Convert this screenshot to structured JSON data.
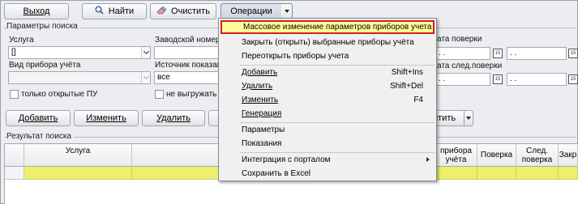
{
  "toolbar": {
    "exit": "Выход",
    "find": "Найти",
    "clear": "Очистить",
    "operations": "Операции"
  },
  "search_params": {
    "title": "Параметры поиска",
    "service_label": "Услуга",
    "service_value": "[]",
    "serial_label": "Заводской номер",
    "device_type_label": "Вид прибора учёта",
    "readings_source_label": "Источник показаний",
    "readings_source_value": "все",
    "only_open_label": "только открытые ПУ",
    "no_export_label": "не выгружать на",
    "verify_date_label": "ата поверки",
    "next_verify_label": "ата след.поверки",
    "date_placeholder": ". .",
    "date_placeholder_2": ". ."
  },
  "actions": {
    "add": "Добавить",
    "edit": "Изменить",
    "delete": "Удалить",
    "right_partial": "итить"
  },
  "results": {
    "title": "Результат поиска",
    "columns": [
      "Услуга",
      "прибора\nучёта",
      "Поверка",
      "След.\nповерка",
      "Закр"
    ]
  },
  "menu": {
    "items": [
      {
        "label": "Массовое изменение параметров приборов учета",
        "shortcut": "",
        "highlighted": true
      },
      {
        "label": "Закрыть (открыть) выбранные приборы учёта",
        "shortcut": ""
      },
      {
        "label": "Переоткрыть приборы учета",
        "shortcut": ""
      },
      {
        "label": "Добавить",
        "shortcut": "Shift+Ins"
      },
      {
        "label": "Удалить",
        "shortcut": "Shift+Del"
      },
      {
        "label": "Изменить",
        "shortcut": "F4"
      },
      {
        "label": "Генерация",
        "shortcut": ""
      },
      {
        "label": "Параметры",
        "shortcut": ""
      },
      {
        "label": "Показания",
        "shortcut": ""
      },
      {
        "label": "Интеграция с порталом",
        "shortcut": ""
      },
      {
        "label": "Сохранить в Excel",
        "shortcut": ""
      }
    ]
  },
  "colors": {
    "highlight_fill": "#fffc9a",
    "highlight_border": "#d41e1e",
    "row_fill": "#ecf06a"
  }
}
